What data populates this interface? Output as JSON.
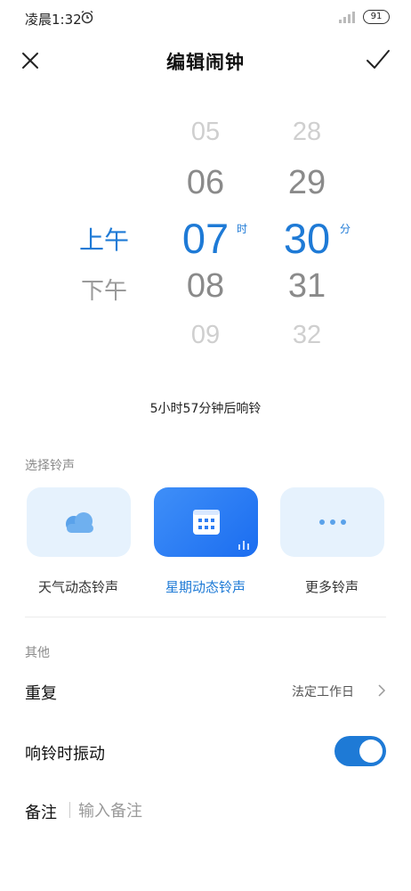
{
  "status_bar": {
    "time": "凌晨1:32",
    "battery": "91"
  },
  "header": {
    "title": "编辑闹钟"
  },
  "picker": {
    "am": "上午",
    "pm": "下午",
    "hours": [
      "05",
      "06",
      "07",
      "08",
      "09"
    ],
    "minutes": [
      "28",
      "29",
      "30",
      "31",
      "32"
    ],
    "hour_unit": "时",
    "minute_unit": "分"
  },
  "hint": "5小时57分钟后响铃",
  "ringtone": {
    "section_label": "选择铃声",
    "options": [
      {
        "label": "天气动态铃声",
        "icon": "cloud-icon"
      },
      {
        "label": "星期动态铃声",
        "icon": "calendar-icon"
      },
      {
        "label": "更多铃声",
        "icon": "more-dots-icon"
      }
    ]
  },
  "other": {
    "section_label": "其他",
    "repeat_label": "重复",
    "repeat_value": "法定工作日",
    "vibrate_label": "响铃时振动",
    "vibrate_on": true,
    "note_label": "备注",
    "note_placeholder": "输入备注"
  },
  "colors": {
    "accent": "#1e7ad6",
    "tile_bg": "#e6f2fd"
  }
}
